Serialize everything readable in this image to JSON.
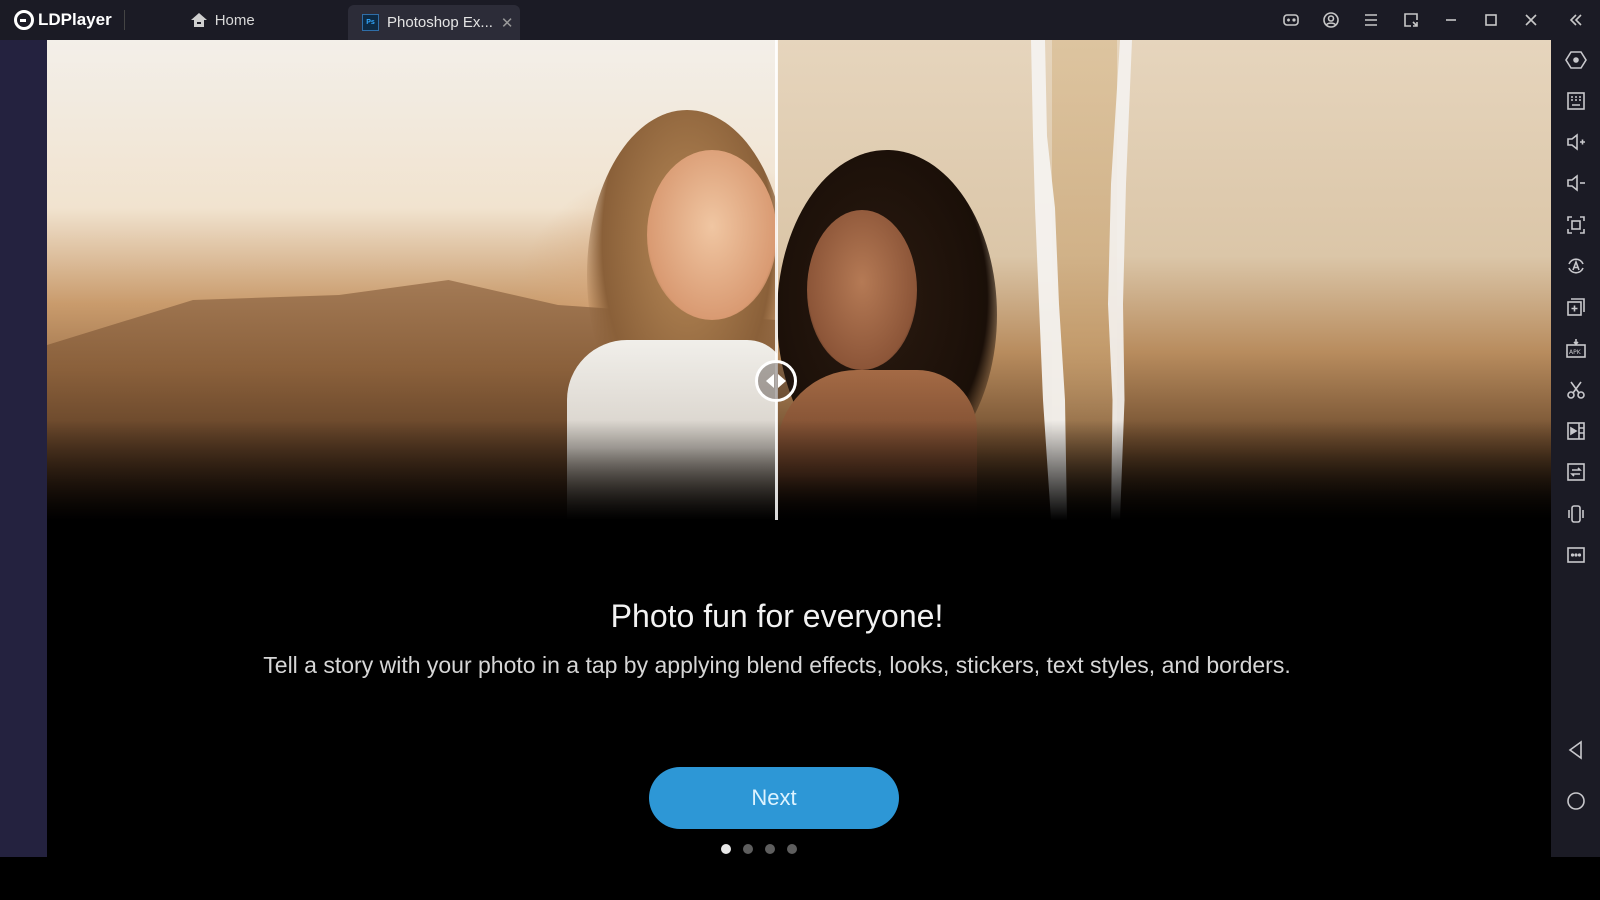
{
  "app": {
    "name": "LDPlayer",
    "tabs": [
      {
        "label": "Home",
        "icon": "home-icon",
        "active": false
      },
      {
        "label": "Photoshop Ex...",
        "icon": "photoshop-express-icon",
        "active": true,
        "close_glyph": "✕"
      }
    ],
    "toolbar": [
      {
        "name": "gamepad-icon"
      },
      {
        "name": "account-icon"
      },
      {
        "name": "menu-icon"
      },
      {
        "name": "window-switch-icon"
      },
      {
        "name": "minimize-icon"
      },
      {
        "name": "maximize-icon"
      },
      {
        "name": "close-icon"
      },
      {
        "name": "collapse-sidebar-icon"
      }
    ],
    "sidebar": [
      {
        "name": "settings-icon"
      },
      {
        "name": "keyboard-mapping-icon"
      },
      {
        "name": "volume-up-icon"
      },
      {
        "name": "volume-down-icon"
      },
      {
        "name": "screenshot-icon"
      },
      {
        "name": "auto-rotate-icon"
      },
      {
        "name": "multi-instance-icon"
      },
      {
        "name": "install-apk-icon"
      },
      {
        "name": "scissors-icon"
      },
      {
        "name": "record-video-icon"
      },
      {
        "name": "sync-icon"
      },
      {
        "name": "shake-icon"
      },
      {
        "name": "more-icon"
      }
    ],
    "android_nav": [
      {
        "name": "back-icon"
      },
      {
        "name": "home-circle-icon"
      }
    ]
  },
  "onboarding": {
    "title": "Photo fun for everyone!",
    "description": "Tell a story with your photo in a tap by applying blend effects, looks, stickers, text styles, and borders.",
    "next_label": "Next",
    "page_count": 4,
    "current_page": 1,
    "accent_color": "#2d97d6"
  }
}
